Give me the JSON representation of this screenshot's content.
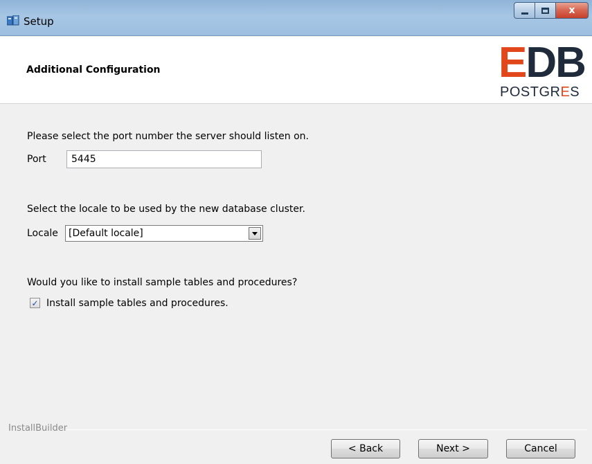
{
  "window": {
    "title": "Setup",
    "close_glyph": "x"
  },
  "header": {
    "title": "Additional Configuration",
    "logo_edb_e": "E",
    "logo_edb_rest": "DB",
    "logo_postgres_prefix": "POSTGR",
    "logo_postgres_accent": "E",
    "logo_postgres_suffix": "S"
  },
  "port": {
    "prompt": "Please select the port number the server should listen on.",
    "label": "Port",
    "value": "5445"
  },
  "locale": {
    "prompt": "Select the locale to be used by the new database cluster.",
    "label": "Locale",
    "selected": "[Default locale]"
  },
  "samples": {
    "prompt": "Would you like to install sample tables and procedures?",
    "checkbox_label": "Install sample tables and procedures.",
    "checked": true
  },
  "footer": {
    "brand": "InstallBuilder",
    "back_label": "< Back",
    "next_label": "Next >",
    "cancel_label": "Cancel"
  },
  "colors": {
    "brand_accent": "#e2471c",
    "brand_dark": "#1f2b3a"
  },
  "icons": {
    "app": "setup-app-icon",
    "minimize": "minimize-icon",
    "maximize": "maximize-icon",
    "close": "close-icon",
    "dropdown": "chevron-down-icon",
    "check": "check-icon"
  }
}
